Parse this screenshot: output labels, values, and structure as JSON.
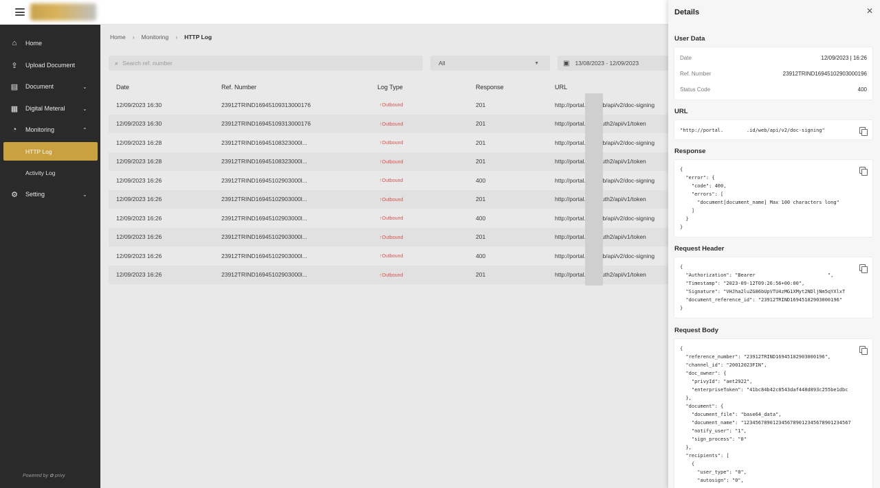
{
  "sidebar": {
    "items": [
      {
        "label": "Home",
        "icon": "home-icon",
        "glyph": "⌂"
      },
      {
        "label": "Upload Document",
        "icon": "upload-icon",
        "glyph": "⇪"
      },
      {
        "label": "Document",
        "icon": "document-icon",
        "glyph": "▤",
        "chevron": "⌄"
      },
      {
        "label": "Digital Meteral",
        "icon": "grid-icon",
        "glyph": "▦",
        "chevron": "⌄"
      },
      {
        "label": "Monitoring",
        "icon": "monitoring-icon",
        "glyph": "◔",
        "chevron": "⌃"
      },
      {
        "label": "Setting",
        "icon": "gear-icon",
        "glyph": "⚙",
        "chevron": "⌄"
      }
    ],
    "sub_items": [
      {
        "label": "HTTP Log",
        "active": true
      },
      {
        "label": "Activity Log",
        "active": false
      }
    ],
    "powered_by": "Powered by  ✿ privy"
  },
  "breadcrumb": {
    "home": "Home",
    "monitoring": "Monitoring",
    "current": "HTTP Log",
    "sep": "›"
  },
  "filters": {
    "search_placeholder": "Search ref. number",
    "log_type": "All",
    "date_range": "13/08/2023 - 12/09/2023"
  },
  "table": {
    "headers": [
      "Date",
      "Ref. Number",
      "Log Type",
      "Response",
      "URL"
    ],
    "rows": [
      {
        "date": "12/09/2023 16:30",
        "ref": "23912TRIND16945109313000176",
        "type": "↑Outbound",
        "response": "201",
        "url": "http://portal.        .id/web/api/v2/doc-signing"
      },
      {
        "date": "12/09/2023 16:30",
        "ref": "23912TRIND16945109313000176",
        "type": "↑Outbound",
        "response": "201",
        "url": "http://portal.        .id/oauth2/api/v1/token"
      },
      {
        "date": "12/09/2023 16:28",
        "ref": "23912TRIND16945108323000l...",
        "type": "↑Outbound",
        "response": "201",
        "url": "http://portal.        .id/web/api/v2/doc-signing"
      },
      {
        "date": "12/09/2023 16:28",
        "ref": "23912TRIND16945108323000l...",
        "type": "↑Outbound",
        "response": "201",
        "url": "http://portal.        .id/oauth2/api/v1/token"
      },
      {
        "date": "12/09/2023 16:26",
        "ref": "23912TRIND16945102903000l...",
        "type": "↑Outbound",
        "response": "400",
        "url": "http://portal.        .id/web/api/v2/doc-signing"
      },
      {
        "date": "12/09/2023 16:26",
        "ref": "23912TRIND16945102903000l...",
        "type": "↑Outbound",
        "response": "201",
        "url": "http://portal.        .id/oauth2/api/v1/token"
      },
      {
        "date": "12/09/2023 16:26",
        "ref": "23912TRIND16945102903000l...",
        "type": "↑Outbound",
        "response": "400",
        "url": "http://portal.        .id/web/api/v2/doc-signing"
      },
      {
        "date": "12/09/2023 16:26",
        "ref": "23912TRIND16945102903000l...",
        "type": "↑Outbound",
        "response": "201",
        "url": "http://portal.        .id/oauth2/api/v1/token"
      },
      {
        "date": "12/09/2023 16:26",
        "ref": "23912TRIND16945102903000l...",
        "type": "↑Outbound",
        "response": "400",
        "url": "http://portal.        .id/web/api/v2/doc-signing"
      },
      {
        "date": "12/09/2023 16:26",
        "ref": "23912TRIND16945102903000l...",
        "type": "↑Outbound",
        "response": "201",
        "url": "http://portal.        .id/oauth2/api/v1/token"
      }
    ]
  },
  "details": {
    "title": "Details",
    "close": "✕",
    "user_data": {
      "title": "User Data",
      "date_label": "Date",
      "date_value": "12/09/2023 | 16:26",
      "ref_label": "Ref. Number",
      "ref_value": "23912TRIND16945102903000196",
      "status_label": "Status Code",
      "status_value": "400"
    },
    "url": {
      "title": "URL",
      "value": "\"http://portal.        .id/web/api/v2/doc-signing\""
    },
    "response": {
      "title": "Response",
      "lines": [
        "{",
        "  \"error\": {",
        "    \"code\": 400,",
        "    \"errors\": [",
        "      \"document[document_name] Max 100 characters long\"",
        "    ]",
        "  }",
        "}"
      ]
    },
    "request_header": {
      "title": "Request Header",
      "lines": [
        "{",
        "  \"Authorization\": \"Bearer                         \",",
        "  \"Timestamp\": \"2023-09-12T09:26:56+00:00\",",
        "  \"Signature\": \"VHJha2luZG86bUpVTU4zMG1XMyt2NDljNm5qYXlxT",
        "  \"document_reference_id\": \"23912TRIND16945102903000196\"",
        "}"
      ]
    },
    "request_body": {
      "title": "Request Body",
      "lines": [
        "{",
        "  \"reference_number\": \"23912TRIND16945102903000196\",",
        "  \"channel_id\": \"20012023FIN\",",
        "  \"doc_owner\": {",
        "    \"privyId\": \"aet2922\",",
        "    \"enterpriseToken\": \"41bc84b42c8543daf448d893c255be1dbc",
        "  },",
        "  \"document\": {",
        "    \"document_file\": \"base64_data\",",
        "    \"document_name\": \"1234567890123456789012345678901234567",
        "    \"notify_user\": \"1\",",
        "    \"sign_process\": \"0\"",
        "  },",
        "  \"recipients\": [",
        "    {",
        "      \"user_type\": \"0\",",
        "      \"autosign\": \"0\","
      ]
    }
  }
}
